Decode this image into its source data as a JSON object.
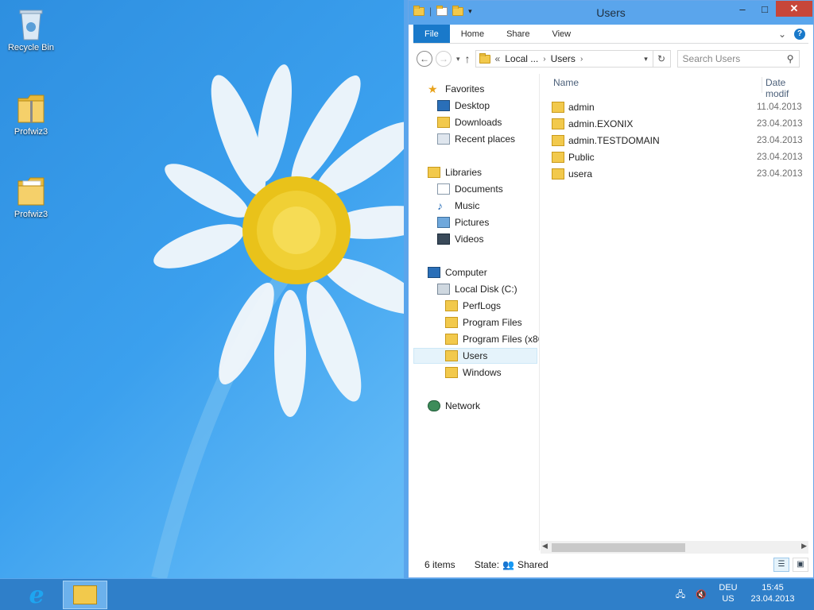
{
  "desktop": {
    "icons": [
      {
        "label": "Recycle Bin",
        "icon": "recycle-bin-icon"
      },
      {
        "label": "Profwiz3",
        "icon": "zip-folder-icon"
      },
      {
        "label": "Profwiz3",
        "icon": "folder-icon"
      }
    ]
  },
  "window": {
    "title": "Users",
    "controls": {
      "minimize": "–",
      "maximize": "□",
      "close": "✕"
    },
    "ribbon_tabs": [
      "File",
      "Home",
      "Share",
      "View"
    ],
    "nav": {
      "back": "←",
      "forward": "→",
      "recent": "▾",
      "up": "↑"
    },
    "address": {
      "prefix": "«",
      "crumbs": [
        "Local ...",
        "Users"
      ]
    },
    "search_placeholder": "Search Users",
    "nav_pane": {
      "favorites": {
        "label": "Favorites",
        "items": [
          "Desktop",
          "Downloads",
          "Recent places"
        ]
      },
      "libraries": {
        "label": "Libraries",
        "items": [
          "Documents",
          "Music",
          "Pictures",
          "Videos"
        ]
      },
      "computer": {
        "label": "Computer",
        "drive": "Local Disk (C:)",
        "folders": [
          "PerfLogs",
          "Program Files",
          "Program Files (x86",
          "Users",
          "Windows"
        ]
      },
      "network": {
        "label": "Network"
      }
    },
    "columns": {
      "name": "Name",
      "date": "Date modif"
    },
    "files": [
      {
        "name": "admin",
        "date": "11.04.2013"
      },
      {
        "name": "admin.EXONIX",
        "date": "23.04.2013"
      },
      {
        "name": "admin.TESTDOMAIN",
        "date": "23.04.2013"
      },
      {
        "name": "Public",
        "date": "23.04.2013"
      },
      {
        "name": "usera",
        "date": "23.04.2013"
      }
    ],
    "status": {
      "items": "6 items",
      "state_label": "State:",
      "state_value": "Shared"
    }
  },
  "taskbar": {
    "apps": [
      "internet-explorer-icon",
      "file-explorer-icon"
    ],
    "lang_top": "DEU",
    "lang_bottom": "US",
    "time": "15:45",
    "date": "23.04.2013"
  }
}
